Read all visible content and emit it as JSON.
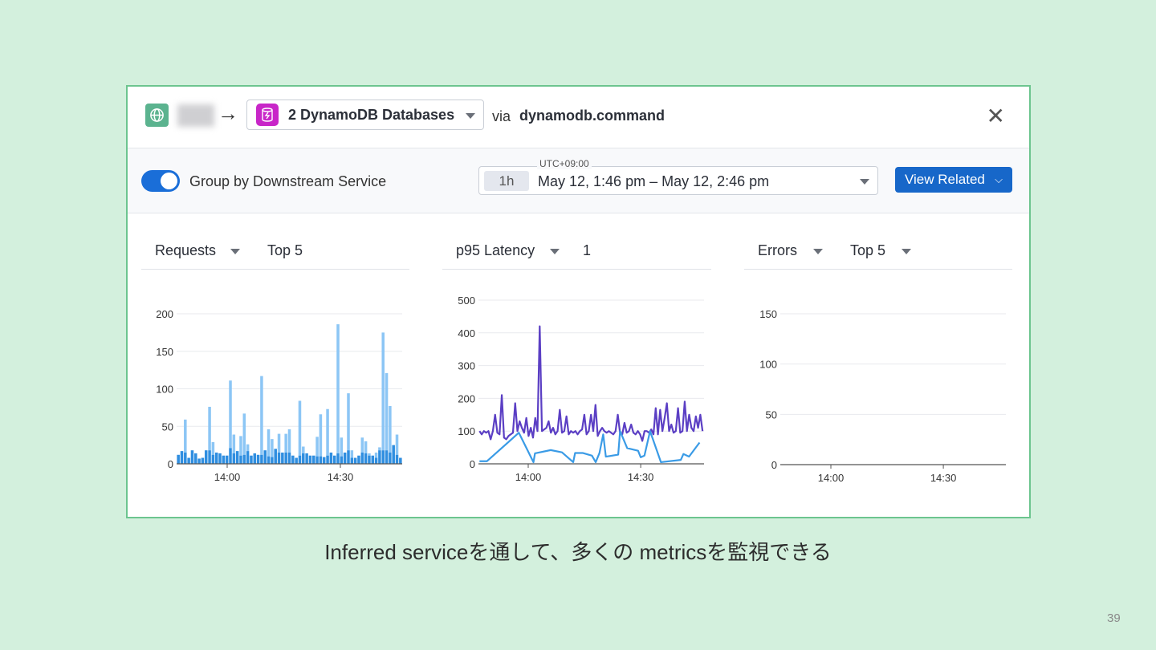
{
  "header": {
    "arrow": "→",
    "databases_dropdown": "2 DynamoDB Databases",
    "via": "via",
    "operation": "dynamodb.command",
    "close": "✕"
  },
  "toolbar": {
    "group_toggle_label": "Group by Downstream Service",
    "group_toggle_on": true,
    "timezone": "UTC+09:00",
    "range_chip": "1h",
    "time_range": "May 12, 1:46 pm – May 12, 2:46 pm",
    "view_related": "View Related"
  },
  "panels": [
    {
      "metric": "Requests",
      "filter": "Top 5"
    },
    {
      "metric": "p95 Latency",
      "filter": "1"
    },
    {
      "metric": "Errors",
      "filter": "Top 5"
    }
  ],
  "colors": {
    "bar_light": "#8cc6f5",
    "bar_dark": "#2f8ee0",
    "line_purple": "#5b3fc4",
    "line_blue": "#3a9be6",
    "accent": "#1767c9"
  },
  "chart_data": [
    {
      "type": "bar",
      "title": "Requests",
      "x_ticks": [
        "14:00",
        "14:30"
      ],
      "y_ticks": [
        "0",
        "50",
        "100",
        "150",
        "200"
      ],
      "ylim": [
        0,
        200
      ],
      "x_range_minutes_from_1400": [
        -13.4,
        46.4
      ],
      "series": [
        {
          "name": "total",
          "values": [
            12,
            17,
            59,
            8,
            18,
            14,
            7,
            8,
            18,
            76,
            29,
            15,
            14,
            11,
            11,
            111,
            39,
            17,
            37,
            67,
            26,
            11,
            14,
            12,
            117,
            18,
            46,
            33,
            20,
            40,
            15,
            40,
            46,
            11,
            8,
            84,
            23,
            14,
            11,
            11,
            36,
            66,
            9,
            73,
            15,
            11,
            186,
            35,
            15,
            94,
            18,
            8,
            11,
            35,
            30,
            14,
            11,
            15,
            22,
            175,
            121,
            77,
            25,
            39,
            8
          ]
        },
        {
          "name": "base",
          "values": [
            12,
            17,
            15,
            8,
            18,
            14,
            7,
            8,
            18,
            18,
            12,
            15,
            14,
            11,
            11,
            21,
            14,
            17,
            11,
            12,
            17,
            11,
            14,
            12,
            12,
            18,
            10,
            9,
            20,
            15,
            15,
            15,
            15,
            11,
            8,
            11,
            14,
            15,
            11,
            11,
            10,
            10,
            9,
            11,
            15,
            11,
            14,
            10,
            15,
            18,
            8,
            11,
            18,
            15,
            14,
            11,
            15,
            8,
            18,
            18,
            18,
            15,
            25,
            12,
            8
          ]
        }
      ]
    },
    {
      "type": "line",
      "title": "p95 Latency",
      "x_ticks": [
        "14:00",
        "14:30"
      ],
      "y_ticks": [
        "0",
        "100",
        "200",
        "300",
        "400",
        "500"
      ],
      "ylim": [
        0,
        500
      ],
      "x_range_minutes_from_1400": [
        -13,
        46.5
      ],
      "series": [
        {
          "name": "purple",
          "values": [
            100,
            90,
            100,
            95,
            100,
            75,
            100,
            150,
            95,
            90,
            210,
            80,
            75,
            85,
            90,
            95,
            185,
            100,
            130,
            110,
            95,
            140,
            85,
            110,
            80,
            140,
            100,
            420,
            100,
            105,
            110,
            130,
            95,
            110,
            90,
            100,
            165,
            95,
            100,
            145,
            90,
            100,
            95,
            100,
            90,
            100,
            105,
            150,
            90,
            100,
            150,
            100,
            180,
            85,
            100,
            110,
            100,
            95,
            100,
            95,
            90,
            100,
            150,
            95,
            90,
            125,
            95,
            100,
            120,
            95,
            90,
            100,
            90,
            70,
            100,
            100,
            95,
            105,
            90,
            170,
            90,
            165,
            100,
            140,
            185,
            100,
            120,
            95,
            100,
            170,
            95,
            100,
            190,
            100,
            150,
            110,
            100,
            145,
            110,
            150,
            100
          ]
        },
        {
          "name": "blue",
          "points": [
            [
              -13,
              8
            ],
            [
              -11,
              8
            ],
            [
              -2.5,
              95
            ],
            [
              1.4,
              5
            ],
            [
              1.8,
              32
            ],
            [
              6,
              42
            ],
            [
              9,
              35
            ],
            [
              12,
              5
            ],
            [
              12.5,
              33
            ],
            [
              14.6,
              33
            ],
            [
              17,
              25
            ],
            [
              18,
              5
            ],
            [
              19,
              33
            ],
            [
              20,
              90
            ],
            [
              20.7,
              22
            ],
            [
              24,
              28
            ],
            [
              24.5,
              100
            ],
            [
              26.4,
              48
            ],
            [
              29.3,
              40
            ],
            [
              30,
              20
            ],
            [
              31,
              25
            ],
            [
              32.5,
              100
            ],
            [
              35.4,
              5
            ],
            [
              40.7,
              12
            ],
            [
              41.4,
              30
            ],
            [
              42.9,
              22
            ],
            [
              45.7,
              65
            ]
          ]
        }
      ]
    },
    {
      "type": "line",
      "title": "Errors",
      "x_ticks": [
        "14:00",
        "14:30"
      ],
      "y_ticks": [
        "0",
        "50",
        "100",
        "150"
      ],
      "ylim": [
        0,
        150
      ],
      "series": []
    }
  ],
  "slide": {
    "caption": "Inferred serviceを通して、多くの metricsを監視できる",
    "page_number": "39"
  }
}
